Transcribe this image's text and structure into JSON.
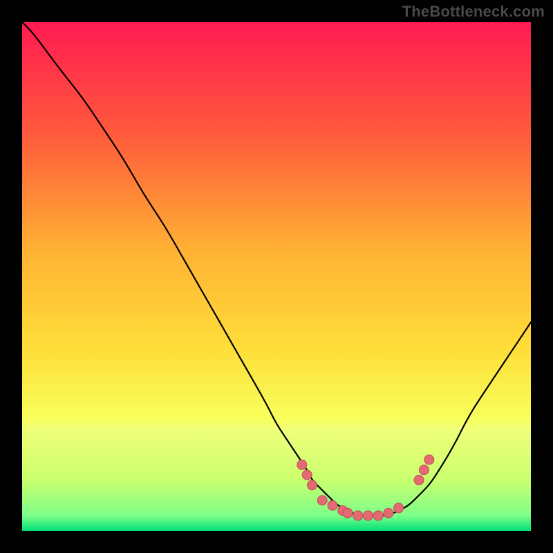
{
  "watermark": "TheBottleneck.com",
  "colors": {
    "background": "#000000",
    "gradient_top": "#ff1a52",
    "gradient_upper_mid": "#ff8a2b",
    "gradient_mid": "#ffe03a",
    "gradient_lower_mid": "#f7ff5c",
    "gradient_band": "#c9ff6e",
    "gradient_bottom": "#00e077",
    "curve": "#000000",
    "dot_fill": "#e36a73",
    "dot_stroke": "#c44b57"
  },
  "chart_data": {
    "type": "line",
    "title": "",
    "xlabel": "",
    "ylabel": "",
    "x": [
      0,
      2,
      5,
      8,
      12,
      16,
      20,
      24,
      28,
      32,
      36,
      40,
      44,
      48,
      50,
      52,
      54,
      56,
      57,
      58,
      60,
      62,
      64,
      66,
      68,
      70,
      72,
      74,
      76,
      78,
      80,
      82,
      85,
      88,
      92,
      96,
      100
    ],
    "values": [
      100,
      98,
      94,
      90,
      85,
      79,
      73,
      66,
      60,
      53,
      46,
      39,
      32,
      25,
      21,
      18,
      15,
      12,
      10,
      9,
      7,
      5,
      4,
      3,
      3,
      3,
      3,
      4,
      5,
      7,
      9,
      12,
      17,
      23,
      29,
      35,
      41
    ],
    "ylim": [
      0,
      100
    ],
    "xlim": [
      0,
      100
    ],
    "dots": [
      {
        "x": 55,
        "y": 13
      },
      {
        "x": 56,
        "y": 11
      },
      {
        "x": 57,
        "y": 9
      },
      {
        "x": 59,
        "y": 6
      },
      {
        "x": 61,
        "y": 5
      },
      {
        "x": 63,
        "y": 4
      },
      {
        "x": 64,
        "y": 3.5
      },
      {
        "x": 66,
        "y": 3
      },
      {
        "x": 68,
        "y": 3
      },
      {
        "x": 70,
        "y": 3
      },
      {
        "x": 72,
        "y": 3.5
      },
      {
        "x": 74,
        "y": 4.5
      },
      {
        "x": 78,
        "y": 10
      },
      {
        "x": 79,
        "y": 12
      },
      {
        "x": 80,
        "y": 14
      }
    ],
    "ideal_band": {
      "ymin": 2,
      "ymax": 22
    }
  }
}
